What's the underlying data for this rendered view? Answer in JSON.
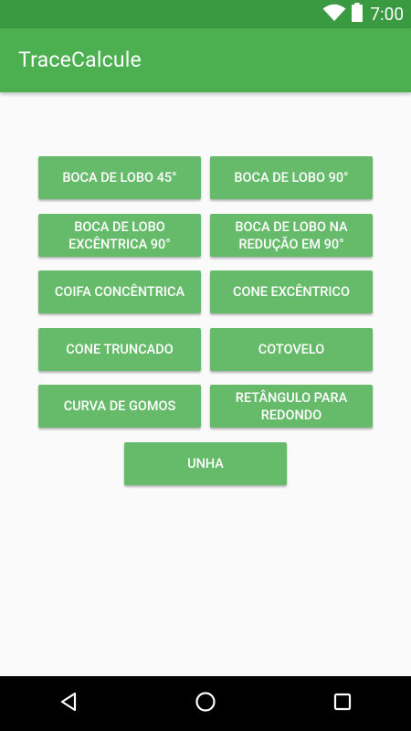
{
  "status_bar": {
    "time": "7:00",
    "wifi_icon": "wifi-icon",
    "battery_icon": "battery-icon"
  },
  "app_bar": {
    "title": "TraceCalcule",
    "color": "#4caf50"
  },
  "buttons": {
    "boca_lobo_45": "BOCA DE LOBO 45°",
    "boca_lobo_90": "BOCA DE LOBO 90°",
    "boca_lobo_excentrica_90": "BOCA DE LOBO\nEXCÊNTRICA 90°",
    "boca_lobo_reducao_90": "BOCA DE LOBO NA\nREDUÇÃO EM 90°",
    "coifa_concentrica": "COIFA CONCÊNTRICA",
    "cone_excentrico": "CONE EXCÊNTRICO",
    "cone_truncado": "CONE TRUNCADO",
    "cotovelo": "COTOVELO",
    "curva_gomos": "CURVA DE GOMOS",
    "retangulo_redondo": "RETÂNGULO PARA\nREDONDO",
    "unha": "UNHA",
    "color": "#66bb6a"
  },
  "nav_bar": {
    "back_icon": "back-icon",
    "home_icon": "home-icon",
    "recents_icon": "recents-icon"
  }
}
